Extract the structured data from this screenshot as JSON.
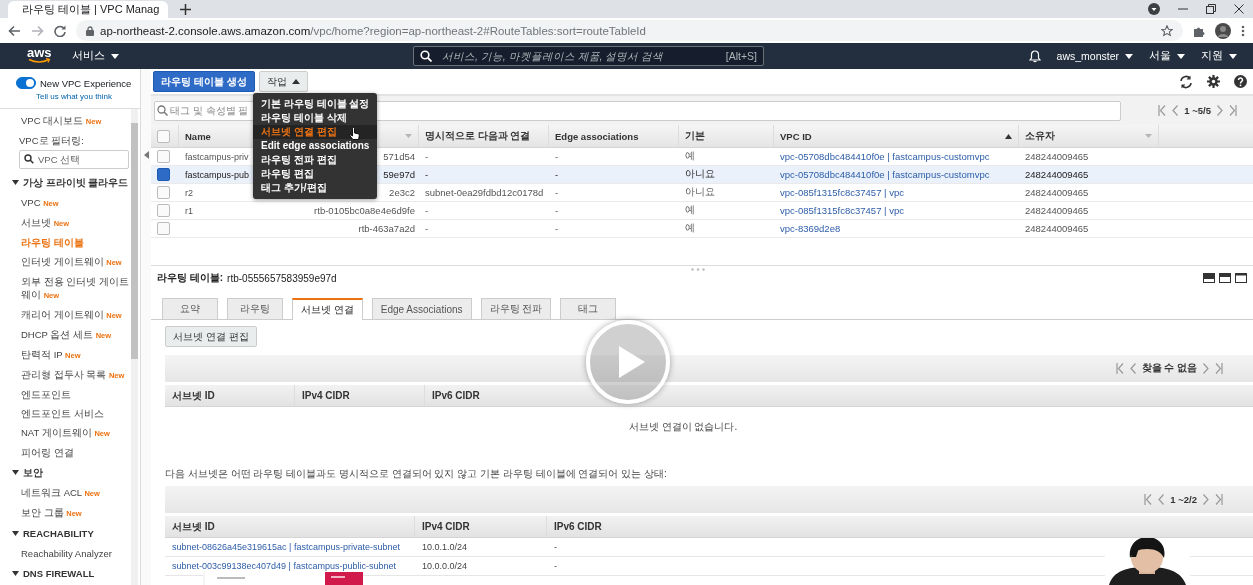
{
  "browser": {
    "tab_title": "라우팅 테이블 | VPC Manag",
    "url_host": "ap-northeast-2.console.aws.amazon.com",
    "url_path": "/vpc/home?region=ap-northeast-2#RouteTables:sort=routeTableId"
  },
  "topnav": {
    "logo": "aws",
    "services": "서비스",
    "search_placeholder": "서비스, 기능, 마켓플레이스 제품, 설명서 검색",
    "shortcut": "[Alt+S]",
    "account": "aws_monster",
    "region": "서울",
    "support": "지원"
  },
  "sidebar": {
    "experience": {
      "label": "New VPC Experience",
      "on": true
    },
    "feedback": "Tell us what you think",
    "items": [
      {
        "kind": "link",
        "label": "VPC 대시보드",
        "badge": "New",
        "selected": false
      },
      {
        "kind": "label",
        "label": "VPC로 필터링:"
      },
      {
        "kind": "field",
        "placeholder": "VPC 선택"
      },
      {
        "kind": "section",
        "label": "가상 프라이빗 클라우드",
        "expanded": true,
        "children": [
          {
            "label": "VPC",
            "badge": "New",
            "selected": false
          },
          {
            "label": "서브넷",
            "badge": "New",
            "selected": false
          },
          {
            "label": "라우팅 테이블",
            "selected": true
          },
          {
            "label": "인터넷 게이트웨이",
            "badge": "New",
            "selected": false
          },
          {
            "label": "외부 전용 인터넷 게이트웨이",
            "badge": "New",
            "selected": false
          },
          {
            "label": "캐리어 게이트웨이",
            "badge": "New",
            "selected": false
          },
          {
            "label": "DHCP 옵션 세트",
            "badge": "New",
            "selected": false
          },
          {
            "label": "탄력적 IP",
            "badge": "New",
            "selected": false
          },
          {
            "label": "관리형 접두사 목록",
            "badge": "New",
            "selected": false
          },
          {
            "label": "엔드포인트",
            "selected": false
          },
          {
            "label": "엔드포인트 서비스",
            "selected": false
          },
          {
            "label": "NAT 게이트웨이",
            "badge": "New",
            "selected": false
          },
          {
            "label": "피어링 연결",
            "selected": false
          }
        ]
      },
      {
        "kind": "section",
        "label": "보안",
        "expanded": true,
        "children": [
          {
            "label": "네트워크 ACL",
            "badge": "New",
            "selected": false
          },
          {
            "label": "보안 그룹",
            "badge": "New",
            "selected": false
          }
        ]
      },
      {
        "kind": "section",
        "label": "REACHABILITY",
        "expanded": true,
        "children": [
          {
            "label": "Reachability Analyzer",
            "selected": false
          }
        ]
      },
      {
        "kind": "section",
        "label": "DNS FIREWALL",
        "expanded": true
      }
    ]
  },
  "toolbar": {
    "create_button": "라우팅 테이블 생성",
    "actions_button": {
      "label": "작업",
      "expanded": true
    },
    "actions_menu": [
      {
        "label": "기본 라우팅 테이블 설정",
        "selected": false
      },
      {
        "label": "라우팅 테이블 삭제",
        "selected": false
      },
      {
        "label": "서브넷 연결 편집",
        "selected": true
      },
      {
        "label": "Edit edge associations",
        "selected": false
      },
      {
        "label": "라우팅 전파 편집",
        "selected": false
      },
      {
        "label": "라우팅 편집",
        "selected": false
      },
      {
        "label": "태그 추가/편집",
        "selected": false
      }
    ]
  },
  "filter": {
    "placeholder": "태그 및 속성별 필",
    "pagination": "1 ~5/5"
  },
  "table": {
    "select_all": {
      "checked": false
    },
    "columns": [
      {
        "kind": "text",
        "label": "Name"
      },
      {
        "kind": "id",
        "sorted": false
      },
      {
        "kind": "text",
        "label": "명시적으로 다음과 연결"
      },
      {
        "kind": "text",
        "label": "Edge associations"
      },
      {
        "kind": "text",
        "label": "기본"
      },
      {
        "kind": "link",
        "label": "VPC ID",
        "sorted": true
      },
      {
        "kind": "text",
        "label": "소유자",
        "sorted": false
      }
    ],
    "rows": [
      {
        "selected": false,
        "cells": [
          "fastcampus-priv",
          "571d54",
          "-",
          "-",
          "예",
          "vpc-05708dbc484410f0e | fastcampus-customvpc",
          "248244009465"
        ]
      },
      {
        "selected": true,
        "cells": [
          "fastcampus-pub",
          "59e97d",
          "-",
          "-",
          "아니요",
          "vpc-05708dbc484410f0e | fastcampus-customvpc",
          "248244009465"
        ]
      },
      {
        "selected": false,
        "cells": [
          "r2",
          "2e3c2",
          "subnet-0ea29fdbd12c0178d",
          "-",
          "아니요",
          "vpc-085f1315fc8c37457 | vpc",
          "248244009465"
        ]
      },
      {
        "selected": false,
        "cells": [
          "r1",
          "rtb-0105bc0a8e4e6d9fe",
          "-",
          "-",
          "예",
          "vpc-085f1315fc8c37457 | vpc",
          "248244009465"
        ]
      },
      {
        "selected": false,
        "cells": [
          null,
          "rtb-463a7a2d",
          "-",
          "-",
          "예",
          "vpc-8369d2e8",
          "248244009465"
        ]
      }
    ]
  },
  "detail": {
    "label": "라우팅 테이블:",
    "value": "rtb-0555657583959e97d",
    "tabs": [
      {
        "label": "요약",
        "selected": false
      },
      {
        "label": "라우팅",
        "selected": false
      },
      {
        "label": "서브넷 연결",
        "selected": true
      },
      {
        "label": "Edge Associations",
        "selected": false
      },
      {
        "label": "라우팅 전파",
        "selected": false
      },
      {
        "label": "태그",
        "selected": false
      }
    ],
    "edit_button": "서브넷 연결 편집",
    "associations": {
      "pagination": "찾을 수 없음",
      "columns": [
        "서브넷 ID",
        "IPv4 CIDR",
        "IPv6 CIDR"
      ],
      "empty_message": "서브넷 연결이 없습니다."
    },
    "note": "다음 서브넷은 어떤 라우팅 테이블과도 명시적으로 연결되어 있지 않고 기본 라우팅 테이블에 연결되어 있는 상태:",
    "implicit": {
      "pagination": "1 ~2/2",
      "columns": [
        "서브넷 ID",
        "IPv4 CIDR",
        "IPv6 CIDR"
      ],
      "rows": [
        {
          "cells": [
            "subnet-08626a45e319615ac | fastcampus-private-subnet",
            "10.0.1.0/24",
            "-"
          ]
        },
        {
          "cells": [
            "subnet-003c99138ec407d49 | fastcampus-public-subnet",
            "10.0.0.0/24",
            "-"
          ]
        }
      ]
    }
  }
}
